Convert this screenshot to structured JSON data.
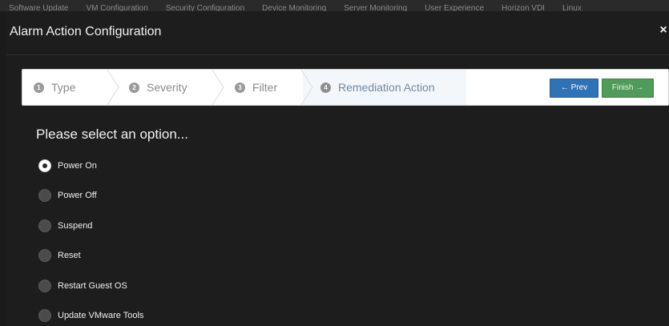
{
  "background_nav": {
    "items": [
      "Software Update",
      "VM Configuration",
      "Security Configuration",
      "Device Monitoring",
      "Server Monitoring",
      "User Experience",
      "Horizon VDI",
      "Linux"
    ]
  },
  "modal": {
    "title": "Alarm Action Configuration",
    "close_label": "×"
  },
  "wizard": {
    "steps": [
      {
        "number": "1",
        "label": "Type",
        "state": "complete"
      },
      {
        "number": "2",
        "label": "Severity",
        "state": "complete"
      },
      {
        "number": "3",
        "label": "Filter",
        "state": "complete"
      },
      {
        "number": "4",
        "label": "Remediation Action",
        "state": "active"
      }
    ],
    "prev_label": "← Prev",
    "finish_label": "Finish →"
  },
  "form": {
    "prompt": "Please select an option...",
    "selected": "Power On",
    "options": [
      {
        "label": "Power On",
        "checked": true
      },
      {
        "label": "Power Off",
        "checked": false
      },
      {
        "label": "Suspend",
        "checked": false
      },
      {
        "label": "Reset",
        "checked": false
      },
      {
        "label": "Restart Guest OS",
        "checked": false
      },
      {
        "label": "Update VMware Tools",
        "checked": false
      }
    ]
  },
  "colors": {
    "prev_button": "#2f72b5",
    "finish_button": "#4f9b59",
    "active_step_text": "#6e8aa3",
    "modal_bg": "#1d1d1d"
  }
}
